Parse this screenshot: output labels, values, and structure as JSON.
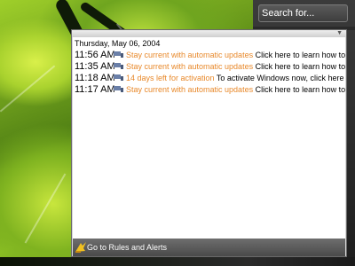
{
  "search": {
    "placeholder": "Search for..."
  },
  "panel": {
    "date_header": "Thursday, May 06, 2004",
    "items": [
      {
        "time": "11:56 AM",
        "subject": "Stay current with automatic updates",
        "body": "Click here to learn how to kee..."
      },
      {
        "time": "11:35 AM",
        "subject": "Stay current with automatic updates",
        "body": "Click here to learn how to kee..."
      },
      {
        "time": "11:18 AM",
        "subject": "14 days left for activation",
        "body": "To activate Windows now, click here"
      },
      {
        "time": "11:17 AM",
        "subject": "Stay current with automatic updates",
        "body": "Click here to learn how to kee..."
      }
    ],
    "footer_label": "Go to Rules and Alerts"
  },
  "icons": {
    "item_icon": "hand-flag-icon",
    "footer_icon": "rules-wizard-icon",
    "collapse_icon": "triangle-down-icon"
  },
  "colors": {
    "subject": "#e8892b",
    "footer_bg": "#5c5c5c",
    "sidebar_bg": "#2e2e2e"
  }
}
